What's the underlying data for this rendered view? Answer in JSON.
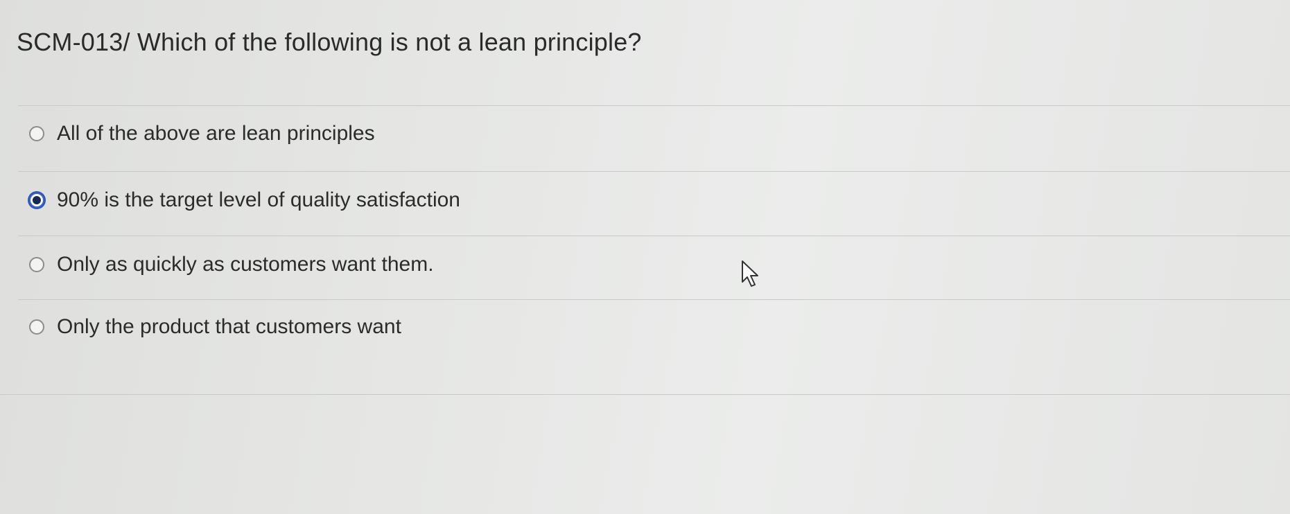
{
  "question": {
    "title": "SCM-013/ Which of the following is not a lean principle?"
  },
  "options": [
    {
      "label": "All of the above are lean principles",
      "selected": false
    },
    {
      "label": "90% is the target level of quality satisfaction",
      "selected": true
    },
    {
      "label": "Only as quickly as customers want them.",
      "selected": false
    },
    {
      "label": "Only the product that customers want",
      "selected": false
    }
  ],
  "colors": {
    "background": "#e6e7e5",
    "text": "#2b2b2b",
    "selected_radio": "#2f56b8",
    "divider": "#c9cac8"
  },
  "icons": {
    "cursor": "mouse-pointer-icon"
  }
}
